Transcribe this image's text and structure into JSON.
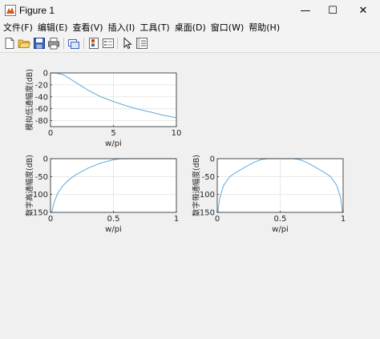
{
  "window": {
    "title": "Figure 1"
  },
  "title_controls": {
    "minimize": "—",
    "maximize": "☐",
    "close": "✕"
  },
  "menu": [
    "文件(F)",
    "编辑(E)",
    "查看(V)",
    "插入(I)",
    "工具(T)",
    "桌面(D)",
    "窗口(W)",
    "帮助(H)"
  ],
  "toolbar": [
    "new-figure-icon",
    "open-file-icon",
    "save-icon",
    "print-icon",
    "link-icon",
    "colorbar-icon",
    "legend-icon",
    "pointer-icon",
    "property-inspector-icon"
  ],
  "colors": {
    "line": "#4d9ed8",
    "axes_bg": "#ffffff",
    "grid": "#e3e3e3"
  },
  "chart_data": [
    {
      "type": "line",
      "xlabel": "w/pi",
      "ylabel": "模拟低通幅度(dB)",
      "xlim": [
        0,
        10
      ],
      "ylim": [
        -90,
        0
      ],
      "xticks": [
        "0",
        "5",
        "10"
      ],
      "yticks": [
        "0",
        "-20",
        "-40",
        "-60",
        "-80"
      ],
      "grid": true,
      "x": [
        0,
        0.5,
        1,
        1.5,
        2,
        3,
        4,
        5,
        6,
        7,
        8,
        9,
        10
      ],
      "y": [
        0,
        -0.4,
        -3,
        -9,
        -16,
        -29,
        -40,
        -48,
        -55,
        -61,
        -66,
        -71,
        -75
      ]
    },
    {
      "type": "line",
      "xlabel": "w/pi",
      "ylabel": "数字高通幅度(dB)",
      "xlim": [
        0,
        1
      ],
      "ylim": [
        -150,
        0
      ],
      "xticks": [
        "0",
        "0.5",
        "1"
      ],
      "yticks": [
        "0",
        "-50",
        "-100",
        "-150"
      ],
      "grid": true,
      "x": [
        0.01,
        0.03,
        0.06,
        0.1,
        0.15,
        0.2,
        0.3,
        0.4,
        0.5,
        0.55,
        0.6,
        0.7,
        0.8,
        0.9,
        1
      ],
      "y": [
        -150,
        -120,
        -95,
        -75,
        -58,
        -45,
        -26,
        -12,
        -3,
        -0.5,
        0,
        0,
        0,
        0,
        0
      ]
    },
    {
      "type": "line",
      "xlabel": "w/pi",
      "ylabel": "数字带通幅度(dB)",
      "xlim": [
        0,
        1
      ],
      "ylim": [
        -150,
        0
      ],
      "xticks": [
        "0",
        "0.5",
        "1"
      ],
      "yticks": [
        "0",
        "-50",
        "-100",
        "-150"
      ],
      "grid": true,
      "x": [
        0.005,
        0.02,
        0.05,
        0.1,
        0.15,
        0.2,
        0.25,
        0.3,
        0.35,
        0.4,
        0.45,
        0.5,
        0.55,
        0.6,
        0.65,
        0.7,
        0.75,
        0.8,
        0.85,
        0.9,
        0.95,
        0.98,
        0.995
      ],
      "y": [
        -150,
        -110,
        -75,
        -50,
        -38,
        -28,
        -18,
        -9,
        -2,
        0,
        0,
        0,
        0,
        0,
        -2,
        -9,
        -18,
        -28,
        -38,
        -50,
        -75,
        -110,
        -150
      ]
    }
  ]
}
